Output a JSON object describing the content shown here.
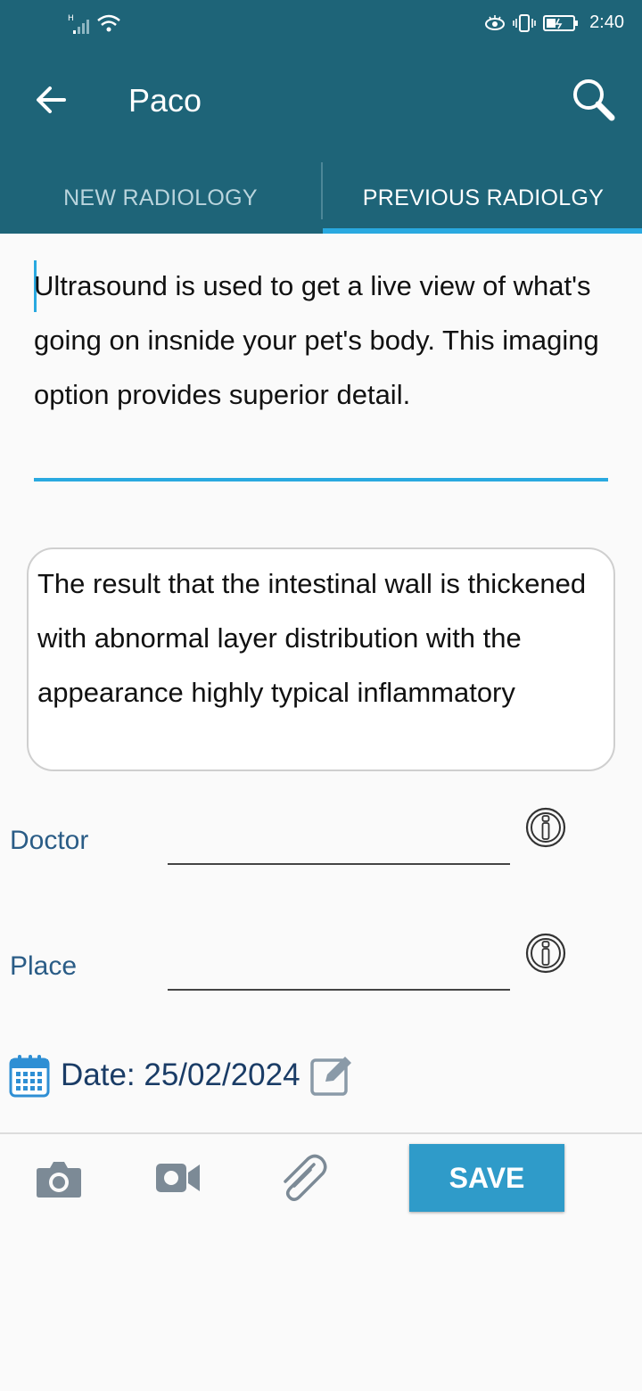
{
  "status_bar": {
    "time": "2:40",
    "network": "H"
  },
  "header": {
    "title": "Paco"
  },
  "tabs": [
    {
      "label": "NEW RADIOLOGY",
      "active": false
    },
    {
      "label": "PREVIOUS RADIOLGY",
      "active": true
    }
  ],
  "description": {
    "value": "Ultrasound is used to get a live view of what's going on insnide your pet's body. This imaging option provides superior detail."
  },
  "result": {
    "value": "The result that the intestinal wall is thickened with abnormal layer distribution with the appearance highly typical inflammatory"
  },
  "form": {
    "doctor_label": "Doctor",
    "doctor_value": "",
    "place_label": "Place",
    "place_value": ""
  },
  "date": {
    "text": "Date: 25/02/2024"
  },
  "toolbar": {
    "save_label": "SAVE"
  },
  "colors": {
    "appbar": "#1e6478",
    "accent": "#29a9e0",
    "save": "#2f9bc9",
    "label": "#2a5c86"
  }
}
